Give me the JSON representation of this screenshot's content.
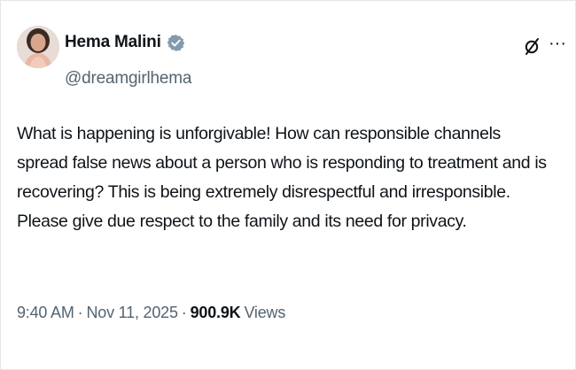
{
  "author": {
    "display_name": "Hema Malini",
    "handle": "@dreamgirlhema",
    "verified_icon": "verified-badge-icon",
    "verified_color": "#829aab"
  },
  "header_actions": {
    "grok_icon": "grok-icon",
    "more_label": "···"
  },
  "tweet": {
    "text": "What is happening is unforgivable! How can responsible channels\nspread false news about a person who is responding to treatment and is\nrecovering? This is being extremely disrespectful and  irresponsible.\nPlease give due respect to the family and its need for privacy."
  },
  "meta": {
    "time": "9:40 AM",
    "separator": "·",
    "date": "Nov 11, 2025",
    "views_count": "900.9K",
    "views_label": "Views"
  },
  "colors": {
    "text_primary": "#0f1419",
    "text_secondary": "#536471",
    "border": "#e6e6e6"
  }
}
